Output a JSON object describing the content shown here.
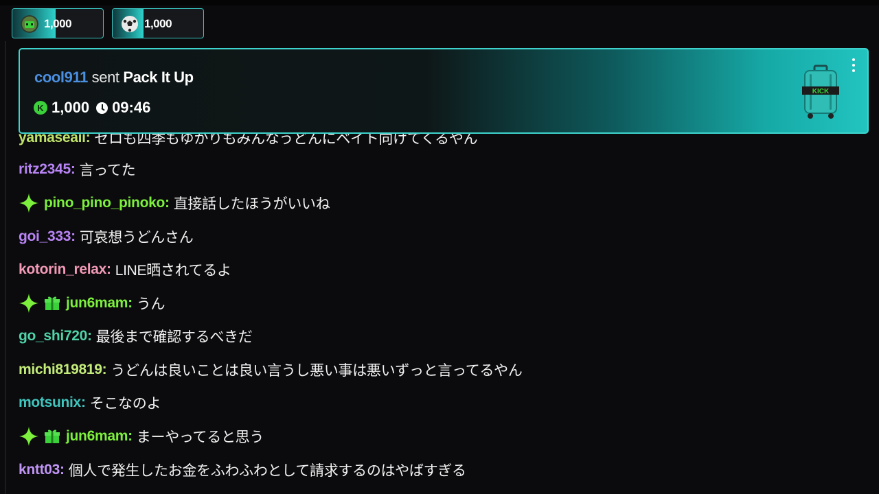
{
  "pinned_gifts": [
    {
      "icon": "avatar-gift-icon",
      "count": "1,000",
      "progress": 0.48
    },
    {
      "icon": "soccer-ball-gift-icon",
      "count": "1,000",
      "progress": 0.34
    }
  ],
  "banner": {
    "user": "cool911",
    "sent_word": "sent",
    "gift_name": "Pack It Up",
    "amount": "1,000",
    "timer": "09:46",
    "coin_letter": "K",
    "suitcase_label": "KICK",
    "gift_icon": "suitcase-icon"
  },
  "messages": [
    {
      "user": "yamaseaii",
      "text": "ゼロも四季もゆかりもみんなうどんにベイト向けてくるやん",
      "color": "#bfe36a",
      "badges": [],
      "clipped": true
    },
    {
      "user": "ritz2345",
      "text": "言ってた",
      "color": "#b985f6",
      "badges": []
    },
    {
      "user": "pino_pino_pinoko",
      "text": "直接話したほうがいいね",
      "color": "#7cf03c",
      "badges": [
        "sparkle-badge-icon"
      ]
    },
    {
      "user": "goi_333",
      "text": "可哀想うどんさん",
      "color": "#b985f6",
      "badges": []
    },
    {
      "user": "kotorin_relax",
      "text": "LINE晒されてるよ",
      "color": "#f39ab7",
      "badges": []
    },
    {
      "user": "jun6mam",
      "text": "うん",
      "color": "#7cf03c",
      "badges": [
        "sparkle-badge-icon",
        "gift-badge-icon"
      ]
    },
    {
      "user": "go_shi720",
      "text": "最後まで確認するべきだ",
      "color": "#4fd3a7",
      "badges": []
    },
    {
      "user": "michi819819",
      "text": "うどんは良いことは良い言うし悪い事は悪いずっと言ってるやん",
      "color": "#c4ec7a",
      "badges": []
    },
    {
      "user": "motsunix",
      "text": "そこなのよ",
      "color": "#41c6be",
      "badges": []
    },
    {
      "user": "jun6mam",
      "text": "まーやってると思う",
      "color": "#7cf03c",
      "badges": [
        "sparkle-badge-icon",
        "gift-badge-icon"
      ]
    },
    {
      "user": "kntt03",
      "text": "個人で発生したお金をふわふわとして請求するのはやばすぎる",
      "color": "#c195f6",
      "badges": []
    }
  ],
  "colors": {
    "background": "#0b0b0d",
    "accent_teal": "#3ed4cd",
    "banner_user": "#4b8fe0",
    "kick_green": "#3ad13a"
  }
}
